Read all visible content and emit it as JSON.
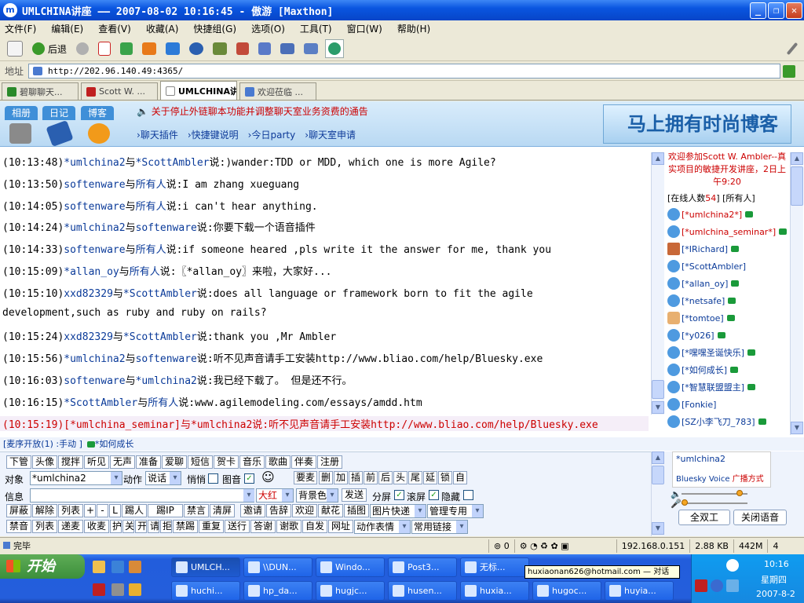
{
  "window": {
    "title": "UMLCHINA讲座 —— 2007-08-02 10:16:45 - 傲游 [Maxthon]"
  },
  "menu": [
    "文件(F)",
    "编辑(E)",
    "查看(V)",
    "收藏(A)",
    "快捷组(G)",
    "选项(O)",
    "工具(T)",
    "窗口(W)",
    "帮助(H)"
  ],
  "toolbar": {
    "back": "后退"
  },
  "address": {
    "label": "地址",
    "url": "http://202.96.140.49:4365/"
  },
  "tabs": [
    "碧聊聊天...",
    "Scott W. ...",
    "UMLCHINA讲...",
    "欢迎莅临 ..."
  ],
  "banner": {
    "tabs": [
      "相册",
      "日记",
      "博客"
    ],
    "notice": "关于停止外链聊本功能并调整聊天室业务资费的通告",
    "links": [
      "聊天插件",
      "快捷键说明",
      "今日party",
      "聊天室申请"
    ],
    "promo": "马上拥有时尚博客"
  },
  "chat": [
    {
      "t": "(10:13:48)",
      "a": "*umlchina2",
      "m": "与",
      "b": "*ScottAmbler",
      "s": "说:",
      "x": ")wander:TDD or MDD, which one is more Agile?"
    },
    {
      "t": "(10:13:50)",
      "a": "softenware",
      "m": "与",
      "b": "所有人",
      "s": "说:",
      "x": "I am zhang xueguang"
    },
    {
      "t": "(10:14:05)",
      "a": "softenware",
      "m": "与",
      "b": "所有人",
      "s": "说:",
      "x": "i can't hear anything."
    },
    {
      "t": "(10:14:24)",
      "a": "*umlchina2",
      "m": "与",
      "b": "softenware",
      "s": "说:",
      "x": "你要下载一个语音插件"
    },
    {
      "t": "(10:14:33)",
      "a": "softenware",
      "m": "与",
      "b": "所有人",
      "s": "说:",
      "x": "if someone heared ,pls write it the answer for me, thank you"
    },
    {
      "t": "(10:15:09)",
      "a": "*allan_oy",
      "m": "与",
      "b": "所有人",
      "s": "说:",
      "x": "〖*allan_oy〗来啦，大家好..."
    },
    {
      "t": "(10:15:10)",
      "a": "xxd82329",
      "m": "与",
      "b": "*ScottAmbler",
      "s": "说:",
      "x": "does all language or framework born to fit the agile"
    },
    {
      "t": "",
      "a": "",
      "m": "",
      "b": "",
      "s": "",
      "x": "development,such as ruby and ruby on rails?"
    },
    {
      "t": "(10:15:24)",
      "a": "xxd82329",
      "m": "与",
      "b": "*ScottAmbler",
      "s": "说:",
      "x": "thank you ,Mr Ambler"
    },
    {
      "t": "(10:15:56)",
      "a": "*umlchina2",
      "m": "与",
      "b": "softenware",
      "s": "说:",
      "x": "听不见声音请手工安装http://www.bliao.com/help/Bluesky.exe"
    },
    {
      "t": "(10:16:03)",
      "a": "softenware",
      "m": "与",
      "b": "*umlchina2",
      "s": "说:",
      "x": "我已经下载了。 但是还不行。"
    },
    {
      "t": "(10:16:15)",
      "a": "*ScottAmbler",
      "m": "与",
      "b": "所有人",
      "s": "说:",
      "x": "www.agilemodeling.com/essays/amdd.htm"
    },
    {
      "t": "(10:15:19)",
      "a": "[*umlchina_seminar]",
      "m": "与",
      "b": "*umlchina2",
      "s": "说:",
      "x": "听不见声音请手工安装http://www.bliao.com/help/Bluesky.exe"
    }
  ],
  "userlist": {
    "welcome": "欢迎参加Scott W. Ambler--真实项目的敏捷开发讲座，2日上午9:20",
    "online_label": "[在线人数",
    "online_count": "54",
    "all_label": "] [所有人]",
    "users": [
      {
        "name": "[*umlchina2*]",
        "red": true,
        "icon": "plain"
      },
      {
        "name": "[*umlchina_seminar*]",
        "red": true,
        "icon": "plain"
      },
      {
        "name": "[*IRichard]",
        "red": false,
        "icon": "photo"
      },
      {
        "name": "[*ScottAmbler]",
        "red": false,
        "icon": "plain"
      },
      {
        "name": "[*allan_oy]",
        "red": false,
        "icon": "plain"
      },
      {
        "name": "[*netsafe]",
        "red": false,
        "icon": "plain"
      },
      {
        "name": "[*tomtoe]",
        "red": false,
        "icon": "face"
      },
      {
        "name": "[*y026]",
        "red": false,
        "icon": "plain"
      },
      {
        "name": "[*嘿嘿圣诞快乐]",
        "red": false,
        "icon": "plain"
      },
      {
        "name": "[*如何成长]",
        "red": false,
        "icon": "plain"
      },
      {
        "name": "[*智慧联盟盟主]",
        "red": false,
        "icon": "plain"
      },
      {
        "name": "[Fonkie]",
        "red": false,
        "icon": "plain"
      },
      {
        "name": "[SZ小李飞刀_783]",
        "red": false,
        "icon": "plain"
      }
    ]
  },
  "mic": {
    "text": "[麦序开放(1) :手动 ]",
    "user": "*如何成长"
  },
  "controls": {
    "row1": [
      "下管",
      "头像",
      "搅拌",
      "听见",
      "无声",
      "准备",
      "爱聊",
      "短信",
      "贺卡",
      "音乐",
      "歌曲",
      "伴奏",
      "注册"
    ],
    "target_label": "对象",
    "target_value": "*umlchina2",
    "action_label": "动作",
    "action_value": "说话",
    "whisper": "悄悄",
    "image": "图音",
    "wanted": "要麦",
    "fmt": [
      "删",
      "加",
      "插",
      "前",
      "后",
      "头",
      "尾",
      "延",
      "锁",
      "自"
    ],
    "msg_label": "信息",
    "color_value": "大红",
    "bg_value": "背景色",
    "send": "发送",
    "split": "分屏",
    "scroll": "滚屏",
    "hide": "隐藏",
    "row3a": [
      "屏蔽",
      "解除",
      "列表",
      "+",
      "-",
      "L",
      "踢人",
      "踢IP",
      "禁言",
      "清屏"
    ],
    "row3b": [
      "邀请",
      "告辞",
      "欢迎",
      "献花",
      "插图",
      "图片快递",
      "管理专用"
    ],
    "row4a": [
      "禁音",
      "列表",
      "递麦",
      "收麦",
      "护",
      "关",
      "开",
      "请",
      "拒",
      "禁踢",
      "重复",
      "送行",
      "答谢",
      "谢歌",
      "自发",
      "网址",
      "动作表情",
      "常用链接"
    ]
  },
  "voice": {
    "user": "*umlchina2",
    "app": "Bluesky Voice",
    "mode": "广播方式",
    "duplex": "全双工",
    "close": "关闭语音"
  },
  "status": {
    "text": "完毕",
    "count": "0",
    "ip": "192.168.0.151",
    "speed": "2.88 KB",
    "mem": "442M",
    "num": "4"
  },
  "taskbar": {
    "start": "开始",
    "tasks1": [
      "UMLCH...",
      "\\\\DUN...",
      "Windo...",
      "Post3...",
      "无标..."
    ],
    "tasks2": [
      "huchi...",
      "hp_da...",
      "hugjc...",
      "husen...",
      "huxia...",
      "hugoc...",
      "huyia..."
    ],
    "tooltip": "huxiaonan626@hotmail.com — 对话",
    "time": "10:16",
    "day": "星期四",
    "date": "2007-8-2"
  }
}
